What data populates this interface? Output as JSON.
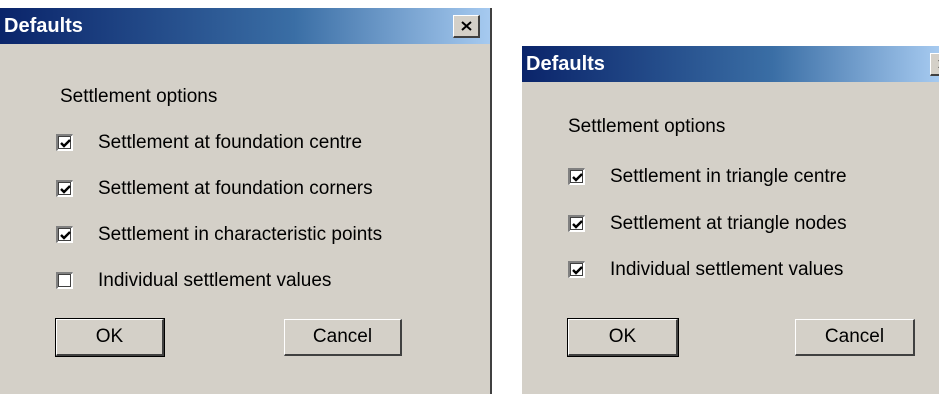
{
  "dialog_1": {
    "title": "Defaults",
    "section_label": "Settlement options",
    "options": [
      {
        "label": "Settlement at foundation centre",
        "checked": true
      },
      {
        "label": "Settlement at foundation corners",
        "checked": true
      },
      {
        "label": "Settlement in characteristic points",
        "checked": true
      },
      {
        "label": "Individual settlement values",
        "checked": false
      }
    ],
    "ok_label": "OK",
    "cancel_label": "Cancel"
  },
  "dialog_2": {
    "title": "Defaults",
    "section_label": "Settlement options",
    "options": [
      {
        "label": "Settlement in triangle centre",
        "checked": true
      },
      {
        "label": "Settlement at triangle nodes",
        "checked": true
      },
      {
        "label": "Individual settlement values",
        "checked": true
      }
    ],
    "ok_label": "OK",
    "cancel_label": "Cancel"
  },
  "icons": {
    "close": "close-icon",
    "check": "checkmark-icon"
  },
  "colors": {
    "titlebar_start": "#0a246a",
    "titlebar_end": "#a6caf0",
    "dialog_bg": "#d4d0c8"
  }
}
